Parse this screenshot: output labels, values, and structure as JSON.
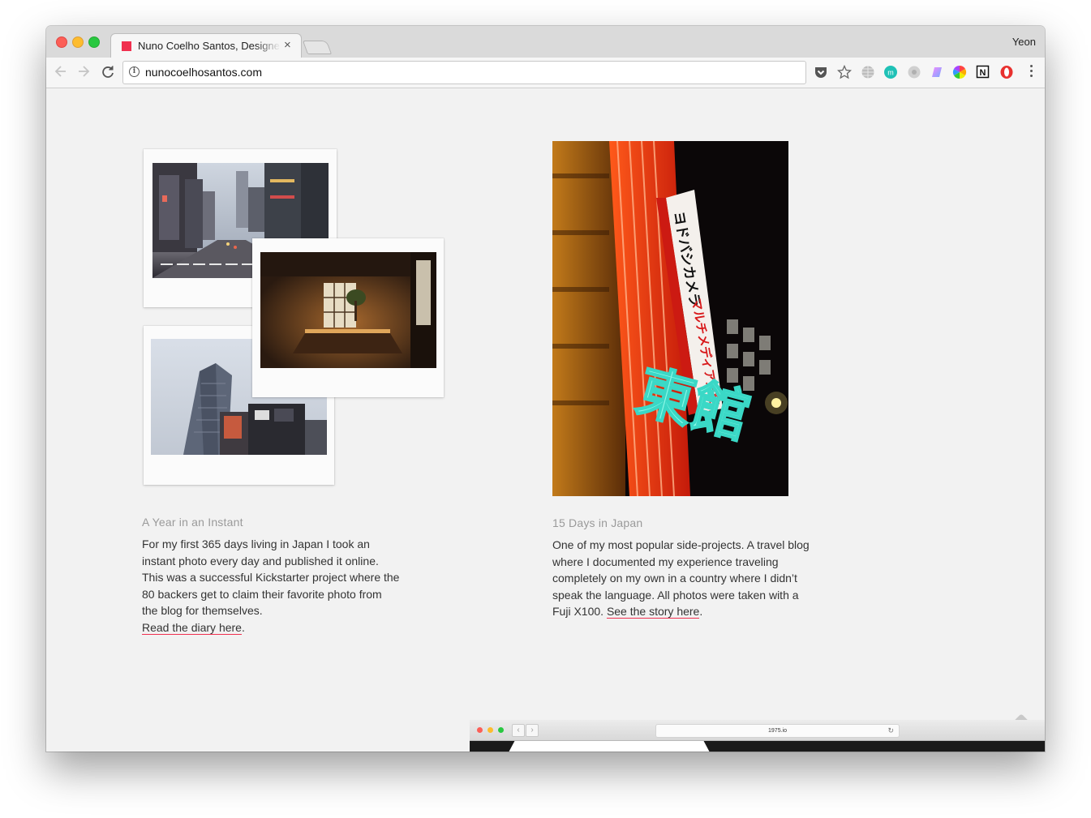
{
  "browser": {
    "tab": {
      "title": "Nuno Coelho Santos, Designer",
      "favicon_color": "#f0304f",
      "close_icon": "×"
    },
    "profile_name": "Yeon",
    "url": "nunocoelhosantos.com",
    "toolbar_icons": [
      "back-icon",
      "forward-icon",
      "reload-icon",
      "site-info-icon",
      "pocket-icon",
      "bookmark-star-icon",
      "globe-extension-icon",
      "mercury-extension-icon",
      "grey-extension-icon",
      "gradient-extension-icon",
      "color-wheel-extension-icon",
      "notion-extension-icon",
      "opera-extension-icon",
      "menu-icon"
    ]
  },
  "projects": [
    {
      "heading": "A Year in an Instant",
      "body": "For my first 365 days living in Japan I took an instant photo every day and published it online. This was a successful Kickstarter project where the 80 backers get to claim their favorite photo from the blog for themselves.",
      "link_text": "Read the diary here",
      "link_suffix": "."
    },
    {
      "heading": "15 Days in Japan",
      "body": "One of my most popular side-projects. A travel blog where I documented my experience traveling completely on my own in a country where I didn’t speak the language. All photos were taken with a Fuji X100.",
      "link_text": "See the story here",
      "link_suffix": "."
    }
  ],
  "neon_sign": {
    "vertical_text": "ヨドバシカメラ",
    "sub_text": "マルチメディア東館",
    "big_text": "東館"
  },
  "preview_site": {
    "url": "1975.io",
    "reload_icon": "↻"
  },
  "accent_color": "#f0304f"
}
